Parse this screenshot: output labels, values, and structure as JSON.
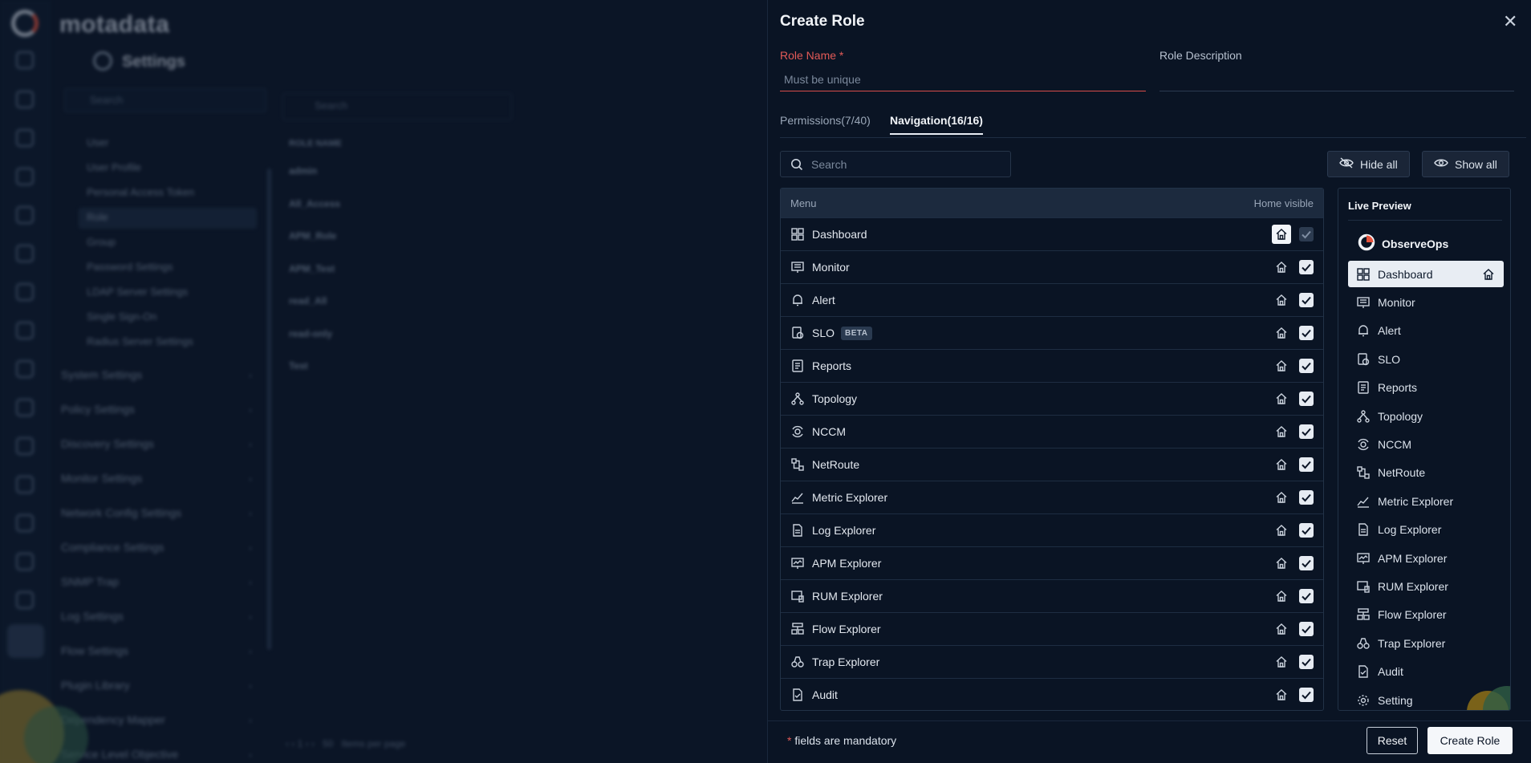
{
  "background": {
    "brand": "motadata",
    "settings_title": "Settings",
    "search_placeholder": "Search",
    "submenu": [
      "User",
      "User Profile",
      "Personal Access Token",
      "Role",
      "Group",
      "Password Settings",
      "LDAP Server Settings",
      "Single Sign-On",
      "Radius Server Settings"
    ],
    "sections": [
      "System Settings",
      "Policy Settings",
      "Discovery Settings",
      "Monitor Settings",
      "Network Config Settings",
      "Compliance Settings",
      "SNMP Trap",
      "Log Settings",
      "Flow Settings",
      "Plugin Library",
      "Dependency Mapper",
      "Service Level Objective"
    ],
    "roles_search_placeholder": "Search",
    "roles_column": "ROLE NAME",
    "roles": [
      "admin",
      "All_Access",
      "APM_Role",
      "APM_Test",
      "read_All",
      "read-only",
      "Test"
    ],
    "pager_size": "50",
    "pager_text": "Items per page"
  },
  "panel": {
    "title": "Create Role",
    "role_name_label": "Role Name",
    "role_name_placeholder": "Must be unique",
    "role_description_label": "Role Description",
    "tabs": [
      {
        "label": "Permissions(7/40)",
        "active": false
      },
      {
        "label": "Navigation(16/16)",
        "active": true
      }
    ],
    "search_placeholder": "Search",
    "hide_all": "Hide all",
    "show_all": "Show all",
    "table": {
      "col_menu": "Menu",
      "col_home": "Home visible",
      "rows": [
        {
          "label": "Dashboard",
          "icon": "dashboard-icon",
          "home": true,
          "visible": true
        },
        {
          "label": "Monitor",
          "icon": "monitor-icon",
          "home": false,
          "visible": true
        },
        {
          "label": "Alert",
          "icon": "bell-icon",
          "home": false,
          "visible": true
        },
        {
          "label": "SLO",
          "icon": "slo-icon",
          "home": false,
          "visible": true,
          "badge": "BETA"
        },
        {
          "label": "Reports",
          "icon": "report-icon",
          "home": false,
          "visible": true
        },
        {
          "label": "Topology",
          "icon": "topology-icon",
          "home": false,
          "visible": true
        },
        {
          "label": "NCCM",
          "icon": "nccm-icon",
          "home": false,
          "visible": true
        },
        {
          "label": "NetRoute",
          "icon": "netroute-icon",
          "home": false,
          "visible": true
        },
        {
          "label": "Metric Explorer",
          "icon": "metric-icon",
          "home": false,
          "visible": true
        },
        {
          "label": "Log Explorer",
          "icon": "log-icon",
          "home": false,
          "visible": true
        },
        {
          "label": "APM Explorer",
          "icon": "apm-icon",
          "home": false,
          "visible": true
        },
        {
          "label": "RUM Explorer",
          "icon": "rum-icon",
          "home": false,
          "visible": true
        },
        {
          "label": "Flow Explorer",
          "icon": "flow-icon",
          "home": false,
          "visible": true
        },
        {
          "label": "Trap Explorer",
          "icon": "trap-icon",
          "home": false,
          "visible": true
        },
        {
          "label": "Audit",
          "icon": "audit-icon",
          "home": false,
          "visible": true
        }
      ]
    },
    "preview": {
      "title": "Live Preview",
      "brand": "ObserveOps",
      "items": [
        "Dashboard",
        "Monitor",
        "Alert",
        "SLO",
        "Reports",
        "Topology",
        "NCCM",
        "NetRoute",
        "Metric Explorer",
        "Log Explorer",
        "APM Explorer",
        "RUM Explorer",
        "Flow Explorer",
        "Trap Explorer",
        "Audit",
        "Setting"
      ],
      "active_item": "Dashboard"
    },
    "footer": {
      "mandatory_star": "*",
      "mandatory_text": " fields are mandatory",
      "reset": "Reset",
      "create": "Create Role"
    }
  },
  "colors": {
    "accent_red": "#e25a57",
    "panel_bg": "#0a1424",
    "page_bg": "#0b1526"
  }
}
